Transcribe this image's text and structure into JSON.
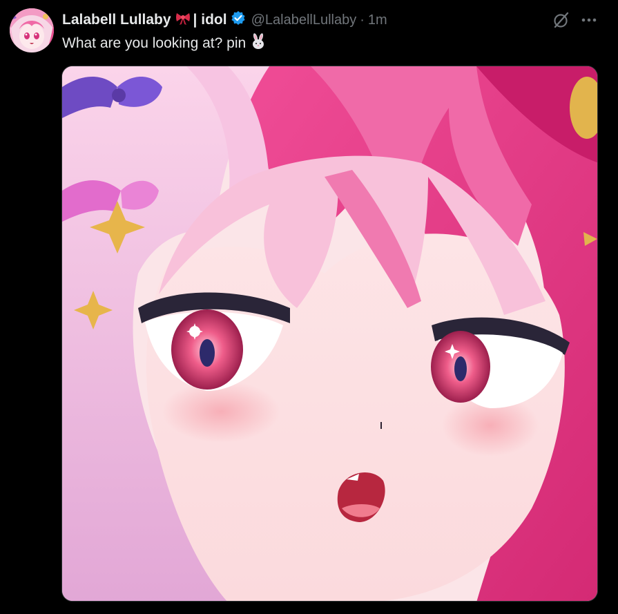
{
  "post": {
    "display_name": "Lalabell Lullaby",
    "name_suffix": "| idol",
    "handle": "@LalabellLullaby",
    "separator": "·",
    "time": "1m",
    "text": "What are you looking at? pin"
  },
  "icons": {
    "avatar": "avatar",
    "ribbon": "ribbon-emoji-icon",
    "verified": "verified-badge-icon",
    "grok": "grok-icon",
    "more": "more-icon",
    "bunny": "rabbit-emoji-icon"
  },
  "colors": {
    "background": "#000000",
    "text": "#e7e9ea",
    "secondary": "#71767b",
    "verified": "#1d9bf0",
    "border": "#2f3336"
  }
}
